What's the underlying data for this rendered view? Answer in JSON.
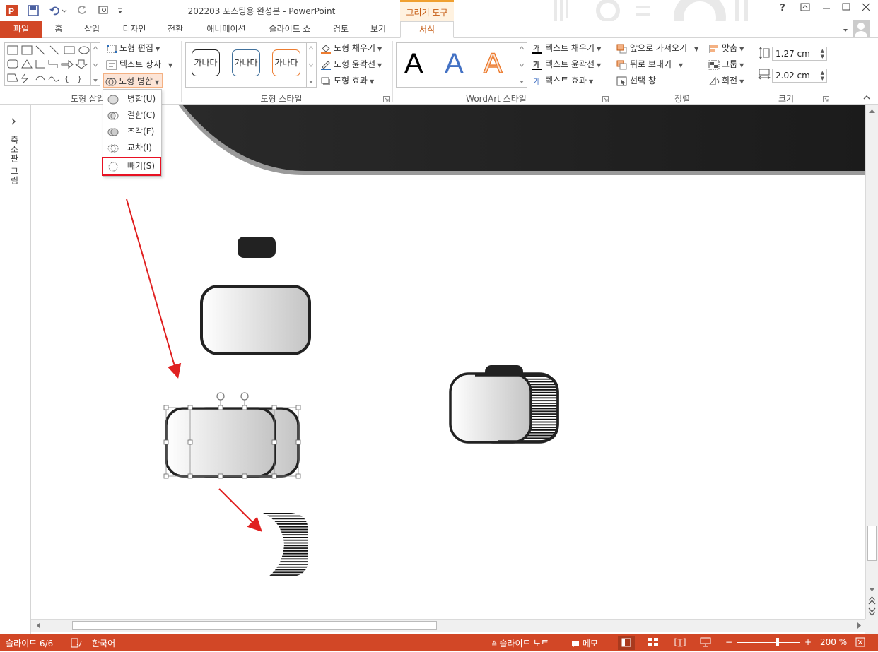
{
  "window": {
    "title": "202203 포스팅용 완성본 - PowerPoint",
    "context_tab_title": "그리기 도구",
    "help_label": "?"
  },
  "tabs": [
    "파일",
    "홈",
    "삽입",
    "디자인",
    "전환",
    "애니메이션",
    "슬라이드 쇼",
    "검토",
    "보기",
    "서식"
  ],
  "ribbon": {
    "insert_shapes": {
      "label": "도형 삽입",
      "edit_shape": "도형 편집",
      "text_box": "텍스트 상자",
      "merge_shapes": "도형 병합"
    },
    "shape_styles": {
      "label": "도형 스타일",
      "style_sample": "가나다",
      "fill": "도형 채우기",
      "outline": "도형 윤곽선",
      "effects": "도형 효과"
    },
    "wordart": {
      "label": "WordArt 스타일",
      "letter": "A",
      "text_fill": "텍스트 채우기",
      "text_outline": "텍스트 윤곽선",
      "text_effects": "텍스트 효과"
    },
    "arrange": {
      "label": "정렬",
      "bring_forward": "앞으로 가져오기",
      "send_backward": "뒤로 보내기",
      "selection_pane": "선택 창",
      "align": "맞춤",
      "group": "그룹",
      "rotate": "회전"
    },
    "size": {
      "label": "크기",
      "height": "1.27 cm",
      "width": "2.02 cm"
    }
  },
  "merge_menu": {
    "items": [
      {
        "label": "병합(U)"
      },
      {
        "label": "결합(C)"
      },
      {
        "label": "조각(F)"
      },
      {
        "label": "교차(I)"
      },
      {
        "label": "빼기(S)"
      }
    ],
    "highlighted_index": 4,
    "highlight_color": "#e81123"
  },
  "left_panel": {
    "label": "축소판 그림"
  },
  "status": {
    "slide": "슬라이드 6/6",
    "language": "한국어",
    "notes": "슬라이드 노트",
    "comments": "메모",
    "zoom": "200 %"
  },
  "colors": {
    "accent": "#d24726",
    "context": "#c55a11",
    "arrow": "#e02020"
  }
}
